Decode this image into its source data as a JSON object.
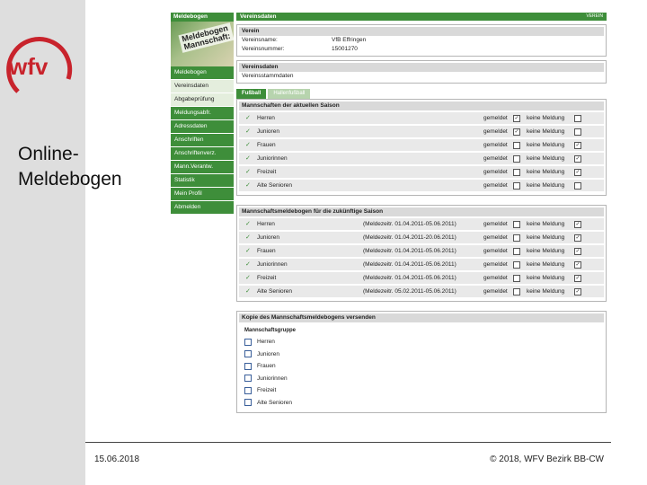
{
  "slide": {
    "title_line1": "Online-",
    "title_line2": "Meldebogen",
    "date": "15.06.2018",
    "copyright": "© 2018, WFV Bezirk BB-CW",
    "logo_text": "wfv",
    "brand_color": "#c8232c"
  },
  "app": {
    "nav_header": "Meldebogen",
    "banner_line1": "Meldebogen",
    "banner_line2": "Mannschaft:",
    "nav_items": [
      {
        "label": "Meldebogen",
        "active": false
      },
      {
        "label": "Vereinsdaten",
        "active": true
      },
      {
        "label": "Abgabeprüfung",
        "active": true
      },
      {
        "label": "Meldungsabfr.",
        "active": false
      },
      {
        "label": "Adressdaten",
        "active": false
      },
      {
        "label": "Anschriften",
        "active": false
      },
      {
        "label": "Anschriftenverz.",
        "active": false
      },
      {
        "label": "Mann.Verantw.",
        "active": false
      },
      {
        "label": "Statistik",
        "active": false
      },
      {
        "label": "Mein Profil",
        "active": false
      },
      {
        "label": "Abmelden",
        "active": false
      }
    ],
    "header_title": "Vereinsdaten",
    "header_right": "VEREIN",
    "verein": {
      "heading": "Verein",
      "name_label": "Vereinsname:",
      "name_value": "VfB Effringen",
      "number_label": "Vereinsnummer:",
      "number_value": "15001270"
    },
    "vereinsdaten": {
      "heading": "Vereinsdaten",
      "link": "Vereinsstammdaten"
    },
    "tabs": [
      {
        "label": "Fußball",
        "on": true
      },
      {
        "label": "Hallenfußball",
        "on": false
      }
    ],
    "current_season": {
      "heading": "Mannschaften der aktuellen Saison",
      "rows": [
        {
          "name": "Herren",
          "reported": "gemeldet",
          "reported_checked": "✓",
          "none": "keine Meldung",
          "none_checked": ""
        },
        {
          "name": "Junioren",
          "reported": "gemeldet",
          "reported_checked": "✓",
          "none": "keine Meldung",
          "none_checked": ""
        },
        {
          "name": "Frauen",
          "reported": "gemeldet",
          "reported_checked": "",
          "none": "keine Meldung",
          "none_checked": "✓"
        },
        {
          "name": "Juniorinnen",
          "reported": "gemeldet",
          "reported_checked": "",
          "none": "keine Meldung",
          "none_checked": "✓"
        },
        {
          "name": "Freizeit",
          "reported": "gemeldet",
          "reported_checked": "",
          "none": "keine Meldung",
          "none_checked": "✓"
        },
        {
          "name": "Alte Senioren",
          "reported": "gemeldet",
          "reported_checked": "",
          "none": "keine Meldung",
          "none_checked": ""
        }
      ]
    },
    "future_season": {
      "heading": "Mannschaftsmeldebogen für die zukünftige Saison",
      "rows": [
        {
          "name": "Herren",
          "period": "(Meldezeitr. 01.04.2011-05.06.2011)",
          "reported": "gemeldet",
          "reported_checked": "",
          "none": "keine Meldung",
          "none_checked": "✓"
        },
        {
          "name": "Junioren",
          "period": "(Meldezeitr. 01.04.2011-20.06.2011)",
          "reported": "gemeldet",
          "reported_checked": "",
          "none": "keine Meldung",
          "none_checked": "✓"
        },
        {
          "name": "Frauen",
          "period": "(Meldezeitr. 01.04.2011-05.06.2011)",
          "reported": "gemeldet",
          "reported_checked": "",
          "none": "keine Meldung",
          "none_checked": "✓"
        },
        {
          "name": "Juniorinnen",
          "period": "(Meldezeitr. 01.04.2011-05.06.2011)",
          "reported": "gemeldet",
          "reported_checked": "",
          "none": "keine Meldung",
          "none_checked": "✓"
        },
        {
          "name": "Freizeit",
          "period": "(Meldezeitr. 01.04.2011-05.06.2011)",
          "reported": "gemeldet",
          "reported_checked": "",
          "none": "keine Meldung",
          "none_checked": "✓"
        },
        {
          "name": "Alte Senioren",
          "period": "(Meldezeitr. 05.02.2011-05.06.2011)",
          "reported": "gemeldet",
          "reported_checked": "",
          "none": "keine Meldung",
          "none_checked": "✓"
        }
      ]
    },
    "copy": {
      "heading": "Kopie des Mannschaftsmeldebogens versenden",
      "subheading": "Mannschaftsgruppe",
      "items": [
        "Herren",
        "Junioren",
        "Frauen",
        "Juniorinnen",
        "Freizeit",
        "Alte Senioren"
      ]
    },
    "accent_color": "#3e8e3a"
  }
}
